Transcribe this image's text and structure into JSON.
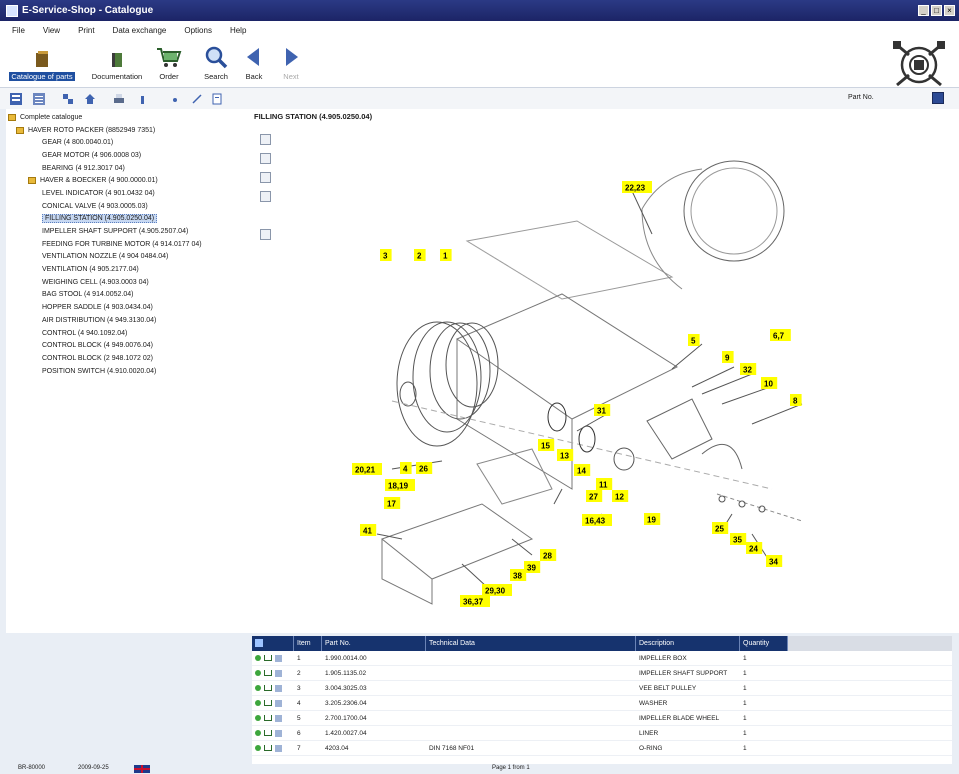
{
  "window": {
    "title": "E-Service-Shop - Catalogue",
    "controls": [
      "_",
      "□",
      "×"
    ]
  },
  "menu": [
    "File",
    "View",
    "Print",
    "Data exchange",
    "Options",
    "Help"
  ],
  "toolbar": {
    "buttons": [
      {
        "label": "Catalogue of parts",
        "icon": "catalogue-icon"
      },
      {
        "label": "Documentation",
        "icon": "documentation-icon"
      },
      {
        "label": "Order",
        "icon": "cart-icon"
      },
      {
        "label": "Search",
        "icon": "search-icon"
      },
      {
        "label": "Back",
        "icon": "back-arrow-icon"
      },
      {
        "label": "Next",
        "icon": "forward-arrow-icon"
      }
    ]
  },
  "search_bar": {
    "label": "Part No."
  },
  "tree": [
    {
      "label": "Complete catalogue",
      "level": 0,
      "folder": true
    },
    {
      "label": "HAVER ROTO PACKER (8852949 7351)",
      "level": 1,
      "folder": true
    },
    {
      "label": "GEAR (4 800.0040.01)",
      "level": 2
    },
    {
      "label": "GEAR MOTOR (4 906.0008 03)",
      "level": 2
    },
    {
      "label": "BEARING (4 912.3017 04)",
      "level": 2
    },
    {
      "label": "HAVER & BOECKER (4 900.0000.01)",
      "level": 2,
      "folder": true
    },
    {
      "label": "LEVEL INDICATOR (4 901.0432 04)",
      "level": 2
    },
    {
      "label": "CONICAL VALVE (4 903.0005.03)",
      "level": 2
    },
    {
      "label": "FILLING STATION (4.905.0250.04)",
      "level": 2,
      "selected": true
    },
    {
      "label": "IMPELLER SHAFT SUPPORT (4.905.2507.04)",
      "level": 2
    },
    {
      "label": "FEEDING FOR TURBINE MOTOR (4 914.0177 04)",
      "level": 2
    },
    {
      "label": "VENTILATION NOZZLE (4 904 0484.04)",
      "level": 2
    },
    {
      "label": "VENTILATION (4 905.2177.04)",
      "level": 2
    },
    {
      "label": "WEIGHING CELL (4.903.0003 04)",
      "level": 2
    },
    {
      "label": "BAG STOOL (4 914.0052.04)",
      "level": 2
    },
    {
      "label": "HOPPER SADDLE (4 903.0434.04)",
      "level": 2
    },
    {
      "label": "AIR DISTRIBUTION (4 949.3130.04)",
      "level": 2
    },
    {
      "label": "CONTROL (4 940.1092.04)",
      "level": 2
    },
    {
      "label": "CONTROL BLOCK (4 949.0076.04)",
      "level": 2
    },
    {
      "label": "CONTROL BLOCK (2 948.1072 02)",
      "level": 2
    },
    {
      "label": "POSITION SWITCH (4.910.0020.04)",
      "level": 2
    }
  ],
  "drawing": {
    "title": "FILLING STATION (4.905.0250.04)",
    "callouts": [
      "22,23",
      "3",
      "2",
      "1",
      "5",
      "6,7",
      "9",
      "32",
      "10",
      "8",
      "31",
      "15",
      "13",
      "14",
      "11",
      "12",
      "27",
      "16,43",
      "19",
      "20,21",
      "4",
      "26",
      "18,19",
      "17",
      "41",
      "25",
      "35",
      "24",
      "34",
      "28",
      "39",
      "38",
      "29,30",
      "36,37"
    ]
  },
  "table": {
    "columns": [
      "",
      "Item",
      "Part No.",
      "Technical Data",
      "Description",
      "Quantity"
    ],
    "rows": [
      {
        "item": "1",
        "part_no": "1.990.0014.00",
        "tech": "",
        "desc": "IMPELLER BOX",
        "qty": "1"
      },
      {
        "item": "2",
        "part_no": "1.905.1135.02",
        "tech": "",
        "desc": "IMPELLER SHAFT SUPPORT",
        "qty": "1"
      },
      {
        "item": "3",
        "part_no": "3.004.3025.03",
        "tech": "",
        "desc": "VEE BELT PULLEY",
        "qty": "1"
      },
      {
        "item": "4",
        "part_no": "3.205.2306.04",
        "tech": "",
        "desc": "WASHER",
        "qty": "1"
      },
      {
        "item": "5",
        "part_no": "2.700.1700.04",
        "tech": "",
        "desc": "IMPELLER BLADE WHEEL",
        "qty": "1"
      },
      {
        "item": "6",
        "part_no": "1.420.0027.04",
        "tech": "",
        "desc": "LINER",
        "qty": "1"
      },
      {
        "item": "7",
        "part_no": "4203.04",
        "tech": "DIN 7168 NF01",
        "desc": "O-RING",
        "qty": "1"
      }
    ]
  },
  "status": {
    "left": "BR-80000",
    "date": "2009-09-25",
    "page": "Page 1 from 1"
  },
  "colors": {
    "titlebar": "#1c2466",
    "accent": "#1f4fa0",
    "highlight": "#ffff00",
    "table_header": "#16336e"
  }
}
